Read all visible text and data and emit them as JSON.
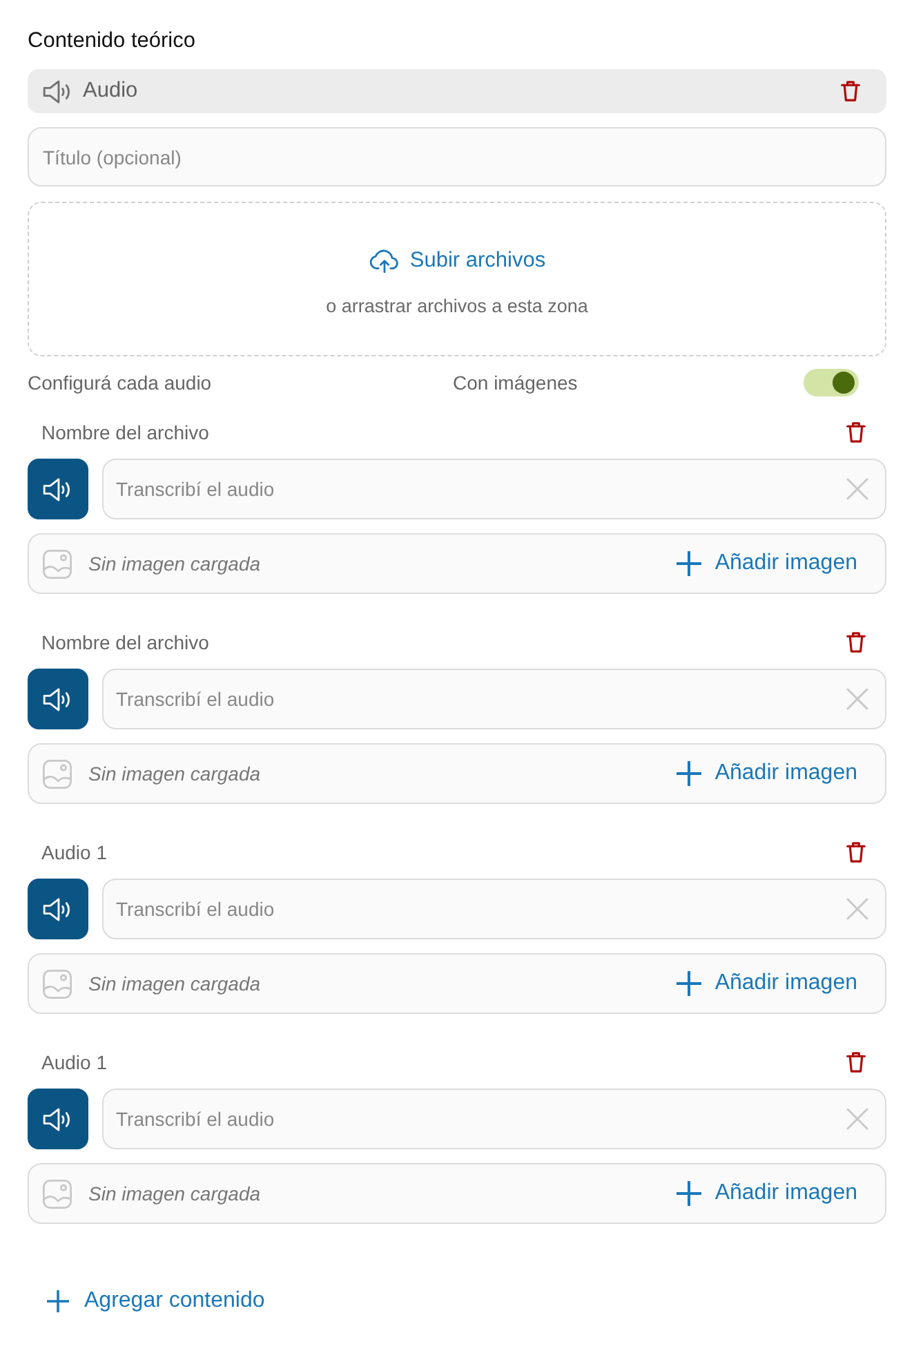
{
  "section": {
    "title": "Contenido teórico"
  },
  "block": {
    "label": "Audio",
    "title_field": {
      "placeholder": "Título (opcional)"
    },
    "dropzone": {
      "upload_link": "Subir archivos",
      "hint": "o arrastrar archivos a esta zona"
    },
    "options": {
      "label": "Configurá cada audio",
      "toggle_label": "Con imágenes",
      "toggle_on": true
    }
  },
  "audios": [
    {
      "name": "Nombre del archivo",
      "transcription": {
        "placeholder": "Transcribí el audio"
      },
      "image": {
        "status": "Sin imagen cargada",
        "action": "Añadir imagen"
      }
    },
    {
      "name": "Nombre del archivo",
      "transcription": {
        "placeholder": "Transcribí el audio"
      },
      "image": {
        "status": "Sin imagen cargada",
        "action": "Añadir imagen"
      }
    },
    {
      "name": "Audio 1",
      "transcription": {
        "placeholder": "Transcribí el audio"
      },
      "image": {
        "status": "Sin imagen cargada",
        "action": "Añadir imagen"
      }
    },
    {
      "name": "Audio 1",
      "transcription": {
        "placeholder": "Transcribí el audio"
      },
      "image": {
        "status": "Sin imagen cargada",
        "action": "Añadir imagen"
      }
    }
  ],
  "add_content": "Agregar contenido"
}
